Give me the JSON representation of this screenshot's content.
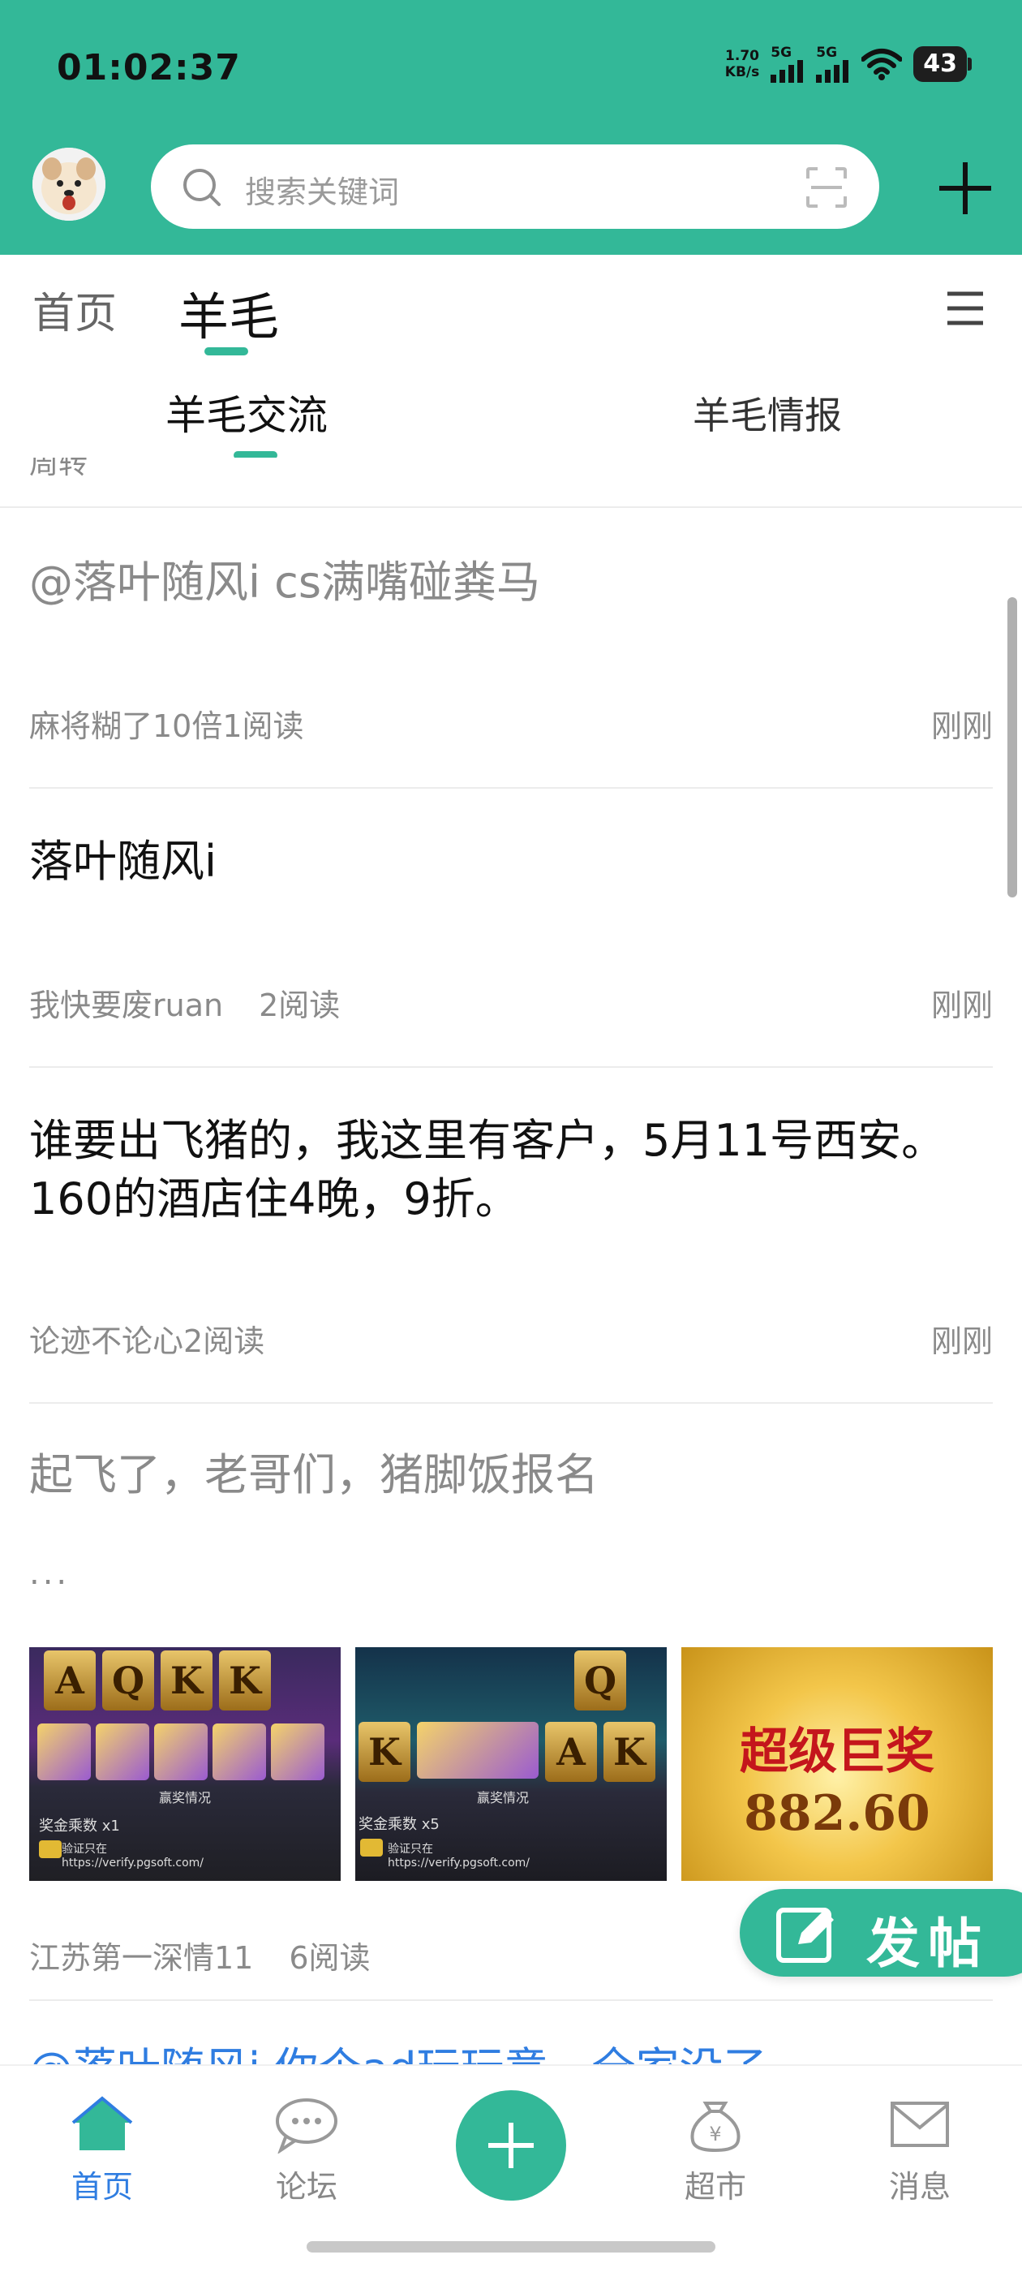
{
  "status_bar": {
    "time": "01:02:37",
    "net_speed_value": "1.70",
    "net_speed_unit": "KB/s",
    "sim1": "5G",
    "sim2": "5G",
    "battery": "43"
  },
  "header": {
    "search_placeholder": "搜索关键词",
    "icons": [
      "avatar",
      "search-icon",
      "scan-icon",
      "plus-icon"
    ]
  },
  "top_tabs": {
    "items": [
      {
        "label": "首页",
        "active": false
      },
      {
        "label": "羊毛",
        "active": true
      }
    ],
    "menu_icon": "menu-icon"
  },
  "sub_tabs": {
    "items": [
      {
        "label": "羊毛交流",
        "active": true
      },
      {
        "label": "羊毛情报",
        "active": false
      }
    ]
  },
  "feed": {
    "cutoff_text": "周转",
    "posts": [
      {
        "title": "@落叶随风i cs满嘴碰粪马",
        "author": "麻将糊了10倍",
        "reads": "1阅读",
        "time": "刚刚"
      },
      {
        "title": "落叶随风i",
        "author": "我快要废ruan",
        "reads": "2阅读",
        "time": "刚刚"
      },
      {
        "title": "谁要出飞猪的，我这里有客户，5月11号西安。160的酒店住4晚，9折。",
        "author": "论迹不论心",
        "reads": "2阅读",
        "time": "刚刚"
      },
      {
        "title": "起飞了，老哥们，猪脚饭报名",
        "ellipsis": "...",
        "author": "江苏第一深情11",
        "reads": "6阅读",
        "images": [
          {
            "cards": [
              "A",
              "Q",
              "K",
              "K"
            ],
            "caption": "赢奖情况",
            "multiplier": "奖金乘数 x1",
            "verify": "验证只在",
            "url": "https://verify.pgsoft.com/"
          },
          {
            "cards": [
              "Q"
            ],
            "cards_bottom": [
              "K",
              "A",
              "K"
            ],
            "caption": "赢奖情况",
            "multiplier": "奖金乘数 x5",
            "verify": "验证只在",
            "url": "https://verify.pgsoft.com/"
          },
          {
            "jackpot_title": "超级巨奖",
            "jackpot_amount": "882.60"
          }
        ]
      }
    ],
    "cutoff_bottom": "@落叶随风i 你个ad玩玩意，全家没了"
  },
  "fab": {
    "label": "发帖",
    "icon": "edit-icon"
  },
  "bottom_nav": {
    "items": [
      {
        "label": "首页",
        "icon": "home-icon",
        "active": true
      },
      {
        "label": "论坛",
        "icon": "chat-icon",
        "active": false
      },
      {
        "label": "",
        "icon": "add-icon",
        "active": false
      },
      {
        "label": "超市",
        "icon": "money-bag-icon",
        "active": false
      },
      {
        "label": "消息",
        "icon": "mail-icon",
        "active": false
      }
    ]
  },
  "colors": {
    "accent": "#33b898",
    "active_nav": "#2f7de1",
    "muted_text": "#8a8a8a"
  }
}
